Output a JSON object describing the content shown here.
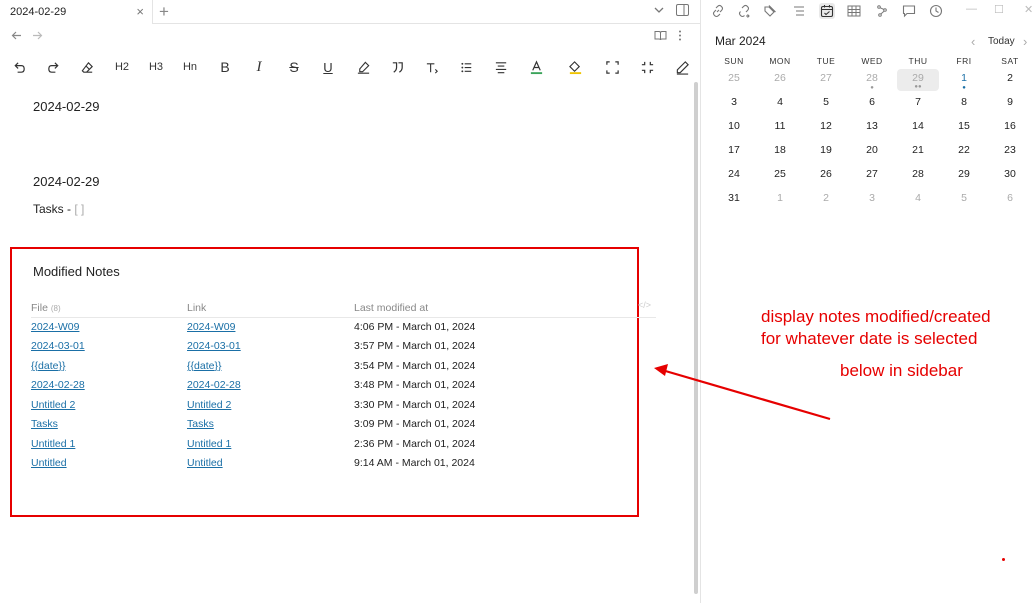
{
  "tab": {
    "title": "2024-02-29",
    "close": "×",
    "new": "+"
  },
  "editor": {
    "heading1": "2024-02-29",
    "heading2": "2024-02-29",
    "tasks_label": "Tasks - ",
    "tasks_bracket": "[ ]"
  },
  "toolbar": {
    "h2": "H2",
    "h3": "H3",
    "hn": "Hn",
    "bold": "B",
    "italic": "I",
    "strike": "S",
    "underline": "U"
  },
  "modified": {
    "title": "Modified Notes",
    "col_file": "File",
    "col_file_count": "(8)",
    "col_link": "Link",
    "col_modified": "Last modified at",
    "rows": [
      {
        "file": "2024-W09",
        "link": "2024-W09",
        "time": "4:06 PM - March 01, 2024"
      },
      {
        "file": "2024-03-01",
        "link": "2024-03-01",
        "time": "3:57 PM - March 01, 2024"
      },
      {
        "file": "{{date}}",
        "link": "{{date}}",
        "time": "3:54 PM - March 01, 2024"
      },
      {
        "file": "2024-02-28",
        "link": "2024-02-28",
        "time": "3:48 PM - March 01, 2024"
      },
      {
        "file": "Untitled 2",
        "link": "Untitled 2",
        "time": "3:30 PM - March 01, 2024"
      },
      {
        "file": "Tasks",
        "link": "Tasks",
        "time": "3:09 PM - March 01, 2024"
      },
      {
        "file": "Untitled 1",
        "link": "Untitled 1",
        "time": "2:36 PM - March 01, 2024"
      },
      {
        "file": "Untitled",
        "link": "Untitled",
        "time": "9:14 AM - March 01, 2024"
      }
    ]
  },
  "annotation": {
    "line1": "display notes modified/created",
    "line2": "for whatever date is selected",
    "line3": "below in sidebar",
    "color": "#e60000"
  },
  "calendar": {
    "month": "Mar 2024",
    "today_label": "Today",
    "weekdays": [
      "SUN",
      "MON",
      "TUE",
      "WED",
      "THU",
      "FRI",
      "SAT"
    ],
    "weeks": [
      [
        "25",
        "26",
        "27",
        "28",
        "29",
        "1",
        "2"
      ],
      [
        "3",
        "4",
        "5",
        "6",
        "7",
        "8",
        "9"
      ],
      [
        "10",
        "11",
        "12",
        "13",
        "14",
        "15",
        "16"
      ],
      [
        "17",
        "18",
        "19",
        "20",
        "21",
        "22",
        "23"
      ],
      [
        "24",
        "25",
        "26",
        "27",
        "28",
        "29",
        "30"
      ],
      [
        "31",
        "1",
        "2",
        "3",
        "4",
        "5",
        "6"
      ]
    ]
  },
  "colors": {
    "link": "#1a6fa6",
    "accent_red": "#e60000"
  }
}
